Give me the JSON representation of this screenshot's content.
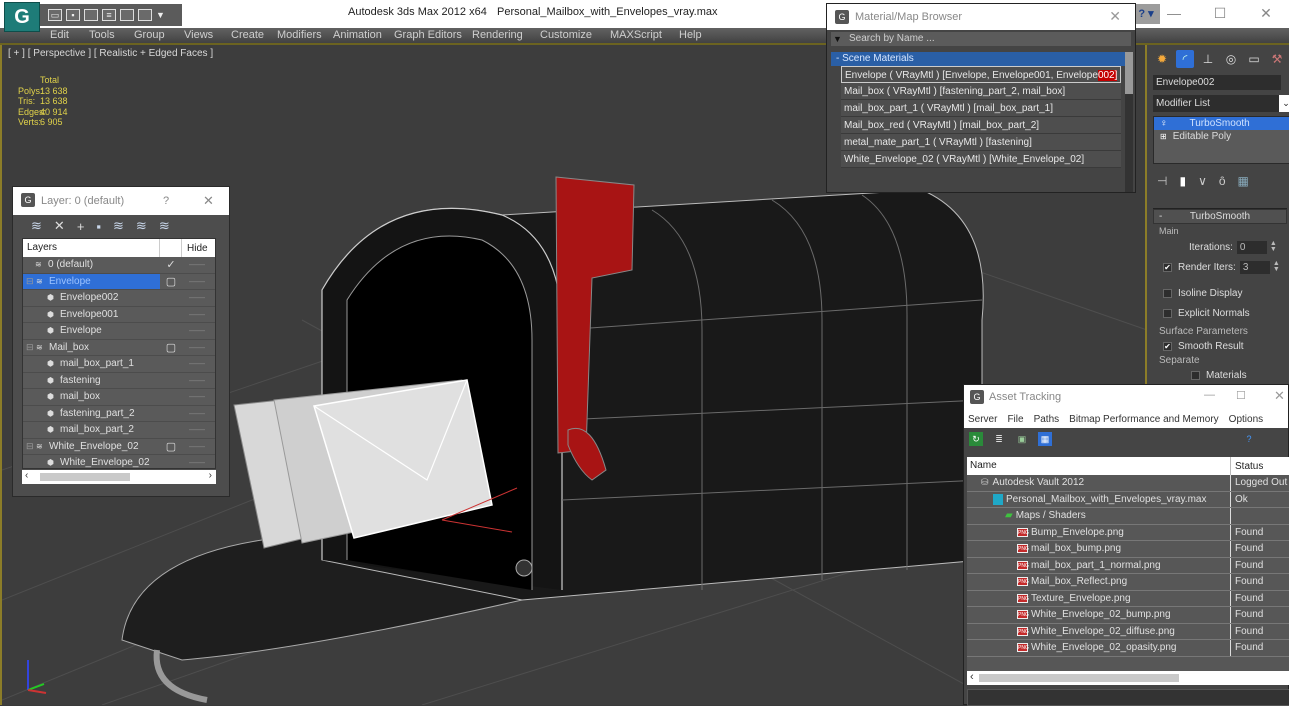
{
  "app": {
    "title": "Autodesk 3ds Max  2012 x64",
    "file": "Personal_Mailbox_with_Envelopes_vray.max",
    "logo_glyph": "G",
    "help_glyph": "?",
    "window_controls": [
      "—",
      "☐",
      "✕"
    ]
  },
  "quick_access": [
    "open-icon",
    "save-icon",
    "new-icon",
    "project-icon",
    "undo-icon",
    "redo-icon",
    "dropdown-icon"
  ],
  "menu": [
    "Edit",
    "Tools",
    "Group",
    "Views",
    "Create",
    "Modifiers",
    "Animation",
    "Graph Editors",
    "Rendering",
    "Customize",
    "MAXScript",
    "Help"
  ],
  "viewport": {
    "label": "[ + ] [ Perspective ] [ Realistic + Edged Faces ]",
    "stats_header": "Total",
    "stats": [
      {
        "label": "Polys:",
        "value": "13 638"
      },
      {
        "label": "Tris:",
        "value": "13 638"
      },
      {
        "label": "Edges:",
        "value": "40 914"
      },
      {
        "label": "Verts:",
        "value": "6 905"
      }
    ],
    "gizmo": {
      "x": "x",
      "y": "y",
      "z": "z"
    },
    "flag_color": "#a81414"
  },
  "layer_dialog": {
    "title": "Layer: 0 (default)",
    "help": "?",
    "close": "✕",
    "toolbar": [
      "new-layer",
      "delete",
      "add-to-layer",
      "select-objects",
      "select-layer",
      "highlight",
      "hide-all"
    ],
    "columns": {
      "layers": "Layers",
      "hide": "Hide"
    },
    "rows": [
      {
        "name": "0 (default)",
        "type": "layer",
        "indent": 1,
        "current": true
      },
      {
        "name": "Envelope",
        "type": "layer",
        "indent": 0,
        "selected": true,
        "expandable": true,
        "box": true
      },
      {
        "name": "Envelope002",
        "type": "object",
        "indent": 2
      },
      {
        "name": "Envelope001",
        "type": "object",
        "indent": 2
      },
      {
        "name": "Envelope",
        "type": "object",
        "indent": 2
      },
      {
        "name": "Mail_box",
        "type": "layer",
        "indent": 0,
        "expandable": true,
        "box": true
      },
      {
        "name": "mail_box_part_1",
        "type": "object",
        "indent": 2
      },
      {
        "name": "fastening",
        "type": "object",
        "indent": 2
      },
      {
        "name": "mail_box",
        "type": "object",
        "indent": 2
      },
      {
        "name": "fastening_part_2",
        "type": "object",
        "indent": 2
      },
      {
        "name": "mail_box_part_2",
        "type": "object",
        "indent": 2
      },
      {
        "name": "White_Envelope_02",
        "type": "layer",
        "indent": 0,
        "expandable": true,
        "box": true
      },
      {
        "name": "White_Envelope_02",
        "type": "object",
        "indent": 2
      }
    ],
    "hide_glyph": "——"
  },
  "material_browser": {
    "title": "Material/Map Browser",
    "search_placeholder": "Search by Name ...",
    "category": "- Scene Materials",
    "materials": [
      {
        "text": "Envelope  ( VRayMtl ) [Envelope, Envelope001, Envelope",
        "highlight": "002]"
      },
      {
        "text": "Mail_box  ( VRayMtl ) [fastening_part_2, mail_box]"
      },
      {
        "text": "mail_box_part_1  ( VRayMtl ) [mail_box_part_1]"
      },
      {
        "text": "Mail_box_red  ( VRayMtl ) [mail_box_part_2]"
      },
      {
        "text": "metal_mate_part_1  ( VRayMtl ) [fastening]"
      },
      {
        "text": "White_Envelope_02  ( VRayMtl ) [White_Envelope_02]"
      }
    ]
  },
  "command_panel": {
    "object_name": "Envelope002",
    "modifier_list": "Modifier List",
    "stack": [
      {
        "name": "TurboSmooth",
        "selected": true
      },
      {
        "name": "Editable Poly",
        "selected": false
      }
    ],
    "rollout": {
      "title": "TurboSmooth",
      "main_group": "Main",
      "iterations_label": "Iterations:",
      "iterations": "0",
      "render_iters_label": "Render Iters:",
      "render_iters": "3",
      "render_iters_checked": true,
      "isoline_label": "Isoline Display",
      "isoline_checked": false,
      "explicit_normals_label": "Explicit Normals",
      "explicit_normals_checked": false,
      "surface_group": "Surface Parameters",
      "smooth_result_label": "Smooth Result",
      "smooth_result_checked": true,
      "separate_label": "Separate",
      "materials_label": "Materials",
      "materials_checked": false
    }
  },
  "asset_tracking": {
    "title": "Asset Tracking",
    "menu": [
      "Server",
      "File",
      "Paths",
      "Bitmap Performance and Memory",
      "Options"
    ],
    "columns": {
      "name": "Name",
      "status": "Status"
    },
    "rows": [
      {
        "name": "Autodesk Vault 2012",
        "status": "Logged Out",
        "icon": "vault",
        "indent": 1
      },
      {
        "name": "Personal_Mailbox_with_Envelopes_vray.max",
        "status": "Ok",
        "icon": "max",
        "indent": 2
      },
      {
        "name": "Maps / Shaders",
        "status": "",
        "icon": "maps",
        "indent": 3
      },
      {
        "name": "Bump_Envelope.png",
        "status": "Found",
        "icon": "png",
        "indent": 4
      },
      {
        "name": "mail_box_bump.png",
        "status": "Found",
        "icon": "png",
        "indent": 4
      },
      {
        "name": "mail_box_part_1_normal.png",
        "status": "Found",
        "icon": "png",
        "indent": 4
      },
      {
        "name": "Mail_box_Reflect.png",
        "status": "Found",
        "icon": "png",
        "indent": 4
      },
      {
        "name": "Texture_Envelope.png",
        "status": "Found",
        "icon": "png",
        "indent": 4
      },
      {
        "name": "White_Envelope_02_bump.png",
        "status": "Found",
        "icon": "png",
        "indent": 4
      },
      {
        "name": "White_Envelope_02_diffuse.png",
        "status": "Found",
        "icon": "png",
        "indent": 4
      },
      {
        "name": "White_Envelope_02_opasity.png",
        "status": "Found",
        "icon": "png",
        "indent": 4
      }
    ]
  }
}
